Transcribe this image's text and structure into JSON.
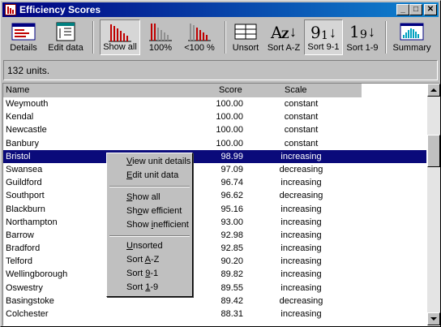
{
  "window": {
    "title": "Efficiency Scores"
  },
  "toolbar": {
    "details": "Details",
    "edit_data": "Edit data",
    "show_all": "Show all",
    "pct100": "100%",
    "lt100": "<100 %",
    "unsort": "Unsort",
    "sort_az": "Sort A-Z",
    "sort_91": "Sort 9-1",
    "sort_19": "Sort 1-9",
    "summary": "Summary",
    "az_glyph_a": "A",
    "az_glyph_z": "Z",
    "n91_glyph": "9",
    "n91_sub": "1",
    "n19_glyph": "1",
    "n19_sub": "9"
  },
  "status": {
    "text": "132 units."
  },
  "table": {
    "headers": {
      "name": "Name",
      "score": "Score",
      "scale": "Scale"
    },
    "rows": [
      {
        "name": "Weymouth",
        "score": "100.00",
        "scale": "constant"
      },
      {
        "name": "Kendal",
        "score": "100.00",
        "scale": "constant"
      },
      {
        "name": "Newcastle",
        "score": "100.00",
        "scale": "constant"
      },
      {
        "name": "Banbury",
        "score": "100.00",
        "scale": "constant"
      },
      {
        "name": "Bristol",
        "score": "98.99",
        "scale": "increasing"
      },
      {
        "name": "Swansea",
        "score": "97.09",
        "scale": "decreasing"
      },
      {
        "name": "Guildford",
        "score": "96.74",
        "scale": "increasing"
      },
      {
        "name": "Southport",
        "score": "96.62",
        "scale": "decreasing"
      },
      {
        "name": "Blackburn",
        "score": "95.16",
        "scale": "increasing"
      },
      {
        "name": "Northampton",
        "score": "93.00",
        "scale": "increasing"
      },
      {
        "name": "Barrow",
        "score": "92.98",
        "scale": "increasing"
      },
      {
        "name": "Bradford",
        "score": "92.85",
        "scale": "increasing"
      },
      {
        "name": "Telford",
        "score": "90.20",
        "scale": "increasing"
      },
      {
        "name": "Wellingborough",
        "score": "89.82",
        "scale": "increasing"
      },
      {
        "name": "Oswestry",
        "score": "89.55",
        "scale": "increasing"
      },
      {
        "name": "Basingstoke",
        "score": "89.42",
        "scale": "decreasing"
      },
      {
        "name": "Colchester",
        "score": "88.31",
        "scale": "increasing"
      }
    ]
  },
  "context_menu": {
    "view_unit_details": {
      "key": "V",
      "rest": "iew unit details"
    },
    "edit_unit_data": {
      "key": "E",
      "rest": "dit unit data"
    },
    "show_all": {
      "key": "S",
      "rest": "how all"
    },
    "show_efficient": {
      "pre": "Sh",
      "key": "o",
      "rest": "w efficient"
    },
    "show_inefficient": {
      "pre": "Show ",
      "key": "i",
      "rest": "nefficient"
    },
    "unsorted": {
      "key": "U",
      "rest": "nsorted"
    },
    "sort_az": {
      "pre": "Sort ",
      "key": "A",
      "rest": "-Z"
    },
    "sort_91": {
      "pre": "Sort ",
      "key": "9",
      "rest": "-1"
    },
    "sort_19": {
      "pre": "Sort ",
      "key": "1",
      "rest": "-9"
    }
  },
  "colors": {
    "selection": "#0a0a7a",
    "titlebar": "#000080",
    "accent_red": "#c00000",
    "summary_cyan": "#00a0c0"
  },
  "icons": [
    "app-icon",
    "details-icon",
    "edit-data-icon",
    "show-all-icon",
    "pct100-icon",
    "lt100-icon",
    "unsort-icon",
    "sort-az-icon",
    "sort-91-icon",
    "sort-19-icon",
    "summary-icon",
    "minimize-icon",
    "maximize-icon",
    "close-icon",
    "scroll-up-icon",
    "scroll-down-icon"
  ]
}
